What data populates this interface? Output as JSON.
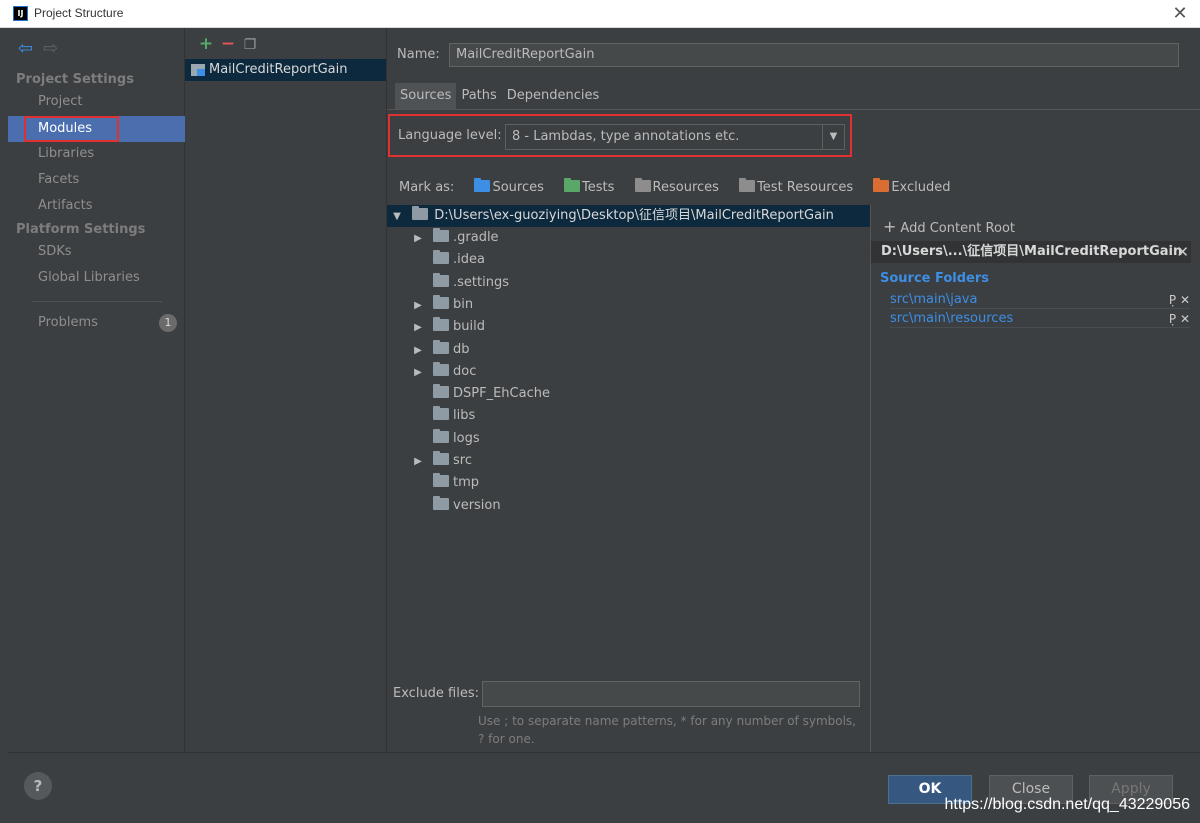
{
  "window": {
    "title": "Project Structure",
    "app_icon": "IJ"
  },
  "leftnav": {
    "section_project": "Project Settings",
    "items_project": [
      "Project",
      "Modules",
      "Libraries",
      "Facets",
      "Artifacts"
    ],
    "section_platform": "Platform Settings",
    "items_platform": [
      "SDKs",
      "Global Libraries"
    ],
    "problems": {
      "label": "Problems",
      "count": "1"
    },
    "selected": "Modules"
  },
  "modules": {
    "list": [
      "MailCreditReportGain"
    ]
  },
  "main": {
    "name_label": "Name:",
    "name_value": "MailCreditReportGain",
    "tabs": [
      "Sources",
      "Paths",
      "Dependencies"
    ],
    "language_level_label": "Language level:",
    "language_level_value": "8 - Lambdas, type annotations etc.",
    "mark_as_label": "Mark as:",
    "mark_as": [
      "Sources",
      "Tests",
      "Resources",
      "Test Resources",
      "Excluded"
    ],
    "tree_root": "D:\\Users\\ex-guoziying\\Desktop\\征信项目\\MailCreditReportGain",
    "tree_items": [
      {
        "name": ".gradle",
        "expandable": true
      },
      {
        "name": ".idea",
        "expandable": false
      },
      {
        "name": ".settings",
        "expandable": false
      },
      {
        "name": "bin",
        "expandable": true
      },
      {
        "name": "build",
        "expandable": true
      },
      {
        "name": "db",
        "expandable": true
      },
      {
        "name": "doc",
        "expandable": true
      },
      {
        "name": "DSPF_EhCache",
        "expandable": false
      },
      {
        "name": "libs",
        "expandable": false
      },
      {
        "name": "logs",
        "expandable": false
      },
      {
        "name": "src",
        "expandable": true
      },
      {
        "name": "tmp",
        "expandable": false
      },
      {
        "name": "version",
        "expandable": false
      }
    ],
    "exclude_label": "Exclude files:",
    "exclude_value": "",
    "hint": "Use ; to separate name patterns, * for any number of symbols, ? for one.",
    "right": {
      "add_content_root": "Add Content Root",
      "root_header": "D:\\Users\\...\\征信项目\\MailCreditReportGain",
      "source_folders_title": "Source Folders",
      "source_folders": [
        "src\\main\\java",
        "src\\main\\resources"
      ]
    }
  },
  "buttons": {
    "ok": "OK",
    "close": "Close",
    "apply": "Apply",
    "help": "?"
  },
  "watermark": "https://blog.csdn.net/qq_43229056",
  "colors": {
    "accent_blue": "#3d8ee5",
    "selection": "#4b6eaf",
    "highlight_red": "#e03131"
  }
}
